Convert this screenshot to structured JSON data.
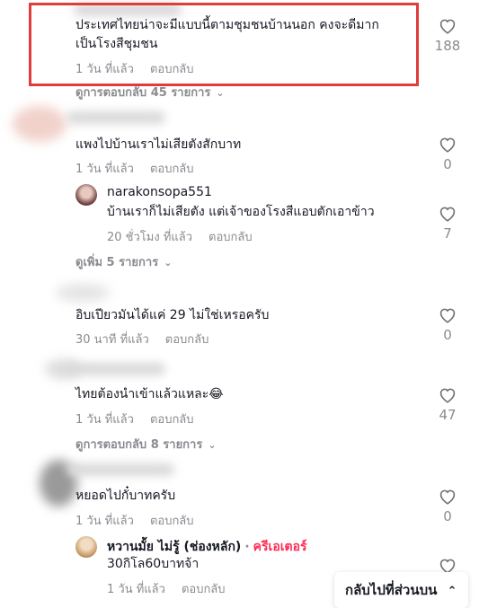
{
  "comments": [
    {
      "text_line1": "ประเทศไทยน่าจะมีแบบนี้ตามชุมชนบ้านนอก คงจะดีมาก",
      "text_line2": "เป็นโรงสีชุมชน",
      "time": "1 วัน ที่แล้ว",
      "reply": "ตอบกลับ",
      "likes": "188",
      "more_replies": "ดูการตอบกลับ 45 รายการ"
    },
    {
      "text": "แพงไปบ้านเราไม่เสียตังสักบาท",
      "time": "1 วัน ที่แล้ว",
      "reply": "ตอบกลับ",
      "likes": "0",
      "sub_reply": {
        "author": "narakonsopa551",
        "text": "บ้านเราก็ไม่เสียตัง แต่เจ้าของโรงสีแอบตักเอาข้าว",
        "time": "20 ชั่วโมง ที่แล้ว",
        "reply": "ตอบกลับ",
        "likes": "7"
      },
      "more_replies": "ดูเพิ่ม 5 รายการ"
    },
    {
      "text": "อิบเปียวมันได้แค่ 29 ไม่ใช่เหรอครับ",
      "time": "30 นาที ที่แล้ว",
      "reply": "ตอบกลับ",
      "likes": "0"
    },
    {
      "text": "ไทยต้องนำเข้าแล้วแหละ😂",
      "time": "1 วัน ที่แล้ว",
      "reply": "ตอบกลับ",
      "likes": "47",
      "more_replies": "ดูการตอบกลับ 8 รายการ"
    },
    {
      "text": "หยอดไปกั๋บาทครับ",
      "time": "1 วัน ที่แล้ว",
      "reply": "ตอบกลับ",
      "likes": "0",
      "sub_reply": {
        "author": "หวานมั้ย ไม่รู้ (ช่องหลัก)",
        "badge": "ครีเอเตอร์",
        "separator": "·",
        "text": "30กิโล60บาทจ้า",
        "time": "1 วัน ที่แล้ว",
        "reply": "ตอบกลับ"
      }
    }
  ],
  "scroll_top_label": "กลับไปที่ส่วนบน",
  "colors": {
    "accent": "#fe2c55",
    "highlight_border": "#e23b3b",
    "meta_text": "#8a8b91"
  },
  "icons": [
    "heart-outline-icon",
    "chevron-down-icon",
    "double-chevron-up-icon"
  ]
}
